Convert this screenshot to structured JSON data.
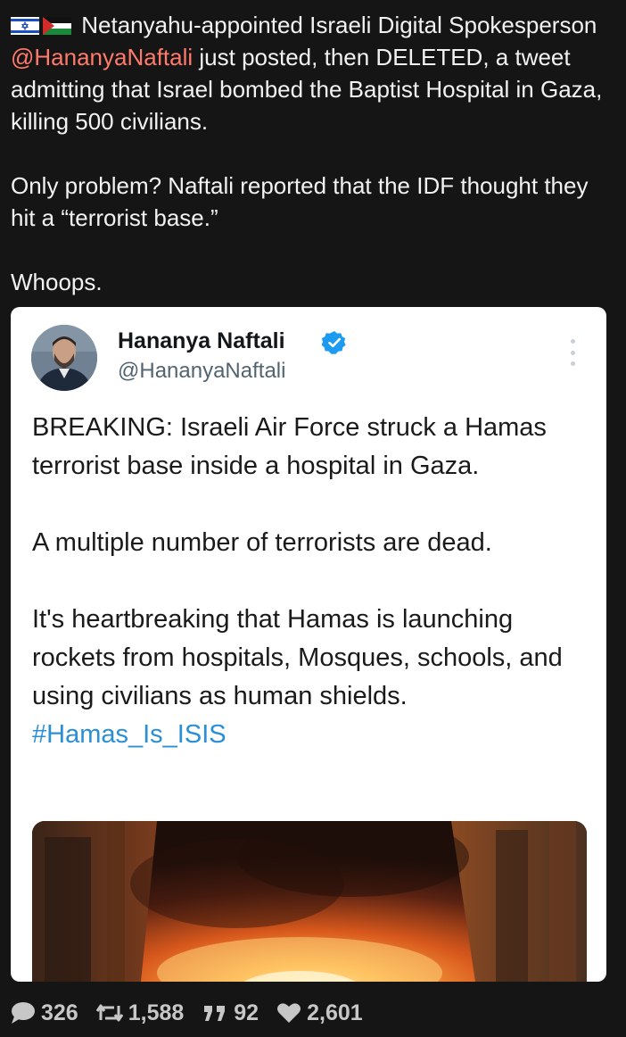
{
  "post": {
    "flags": [
      "israel-flag-icon",
      "palestine-flag-icon"
    ],
    "text_intro": "Netanyahu-appointed Israeli Digital Spokesperson ",
    "mention": "@HananyaNaftali",
    "text_after_mention": " just posted, then DELETED, a tweet admitting that Israel bombed the Baptist Hospital in Gaza, killing 500 civilians.",
    "paragraph_2": "Only problem? Naftali reported that the IDF thought they hit a “terrorist base.”",
    "paragraph_3": "Whoops."
  },
  "embedded_tweet": {
    "author_name": "Hananya Naftali",
    "handle": "@HananyaNaftali",
    "verified": true,
    "paragraph_1": "BREAKING: Israeli Air Force struck a Hamas terrorist base inside a hospital in Gaza.",
    "paragraph_2": "A multiple number of terrorists are dead.",
    "paragraph_3_text": "It's heartbreaking that Hamas is launching rockets from hospitals, Mosques, schools, and using civilians as human shields. ",
    "hashtag": "#Hamas_Is_ISIS",
    "media": "fire-photo"
  },
  "actions": {
    "replies": "326",
    "reposts": "1,588",
    "quotes": "92",
    "likes": "2,601"
  },
  "colors": {
    "background": "#151515",
    "mention": "#ff7a6b",
    "hashtag": "#2a8fd6",
    "verified": "#1d9bf0"
  }
}
